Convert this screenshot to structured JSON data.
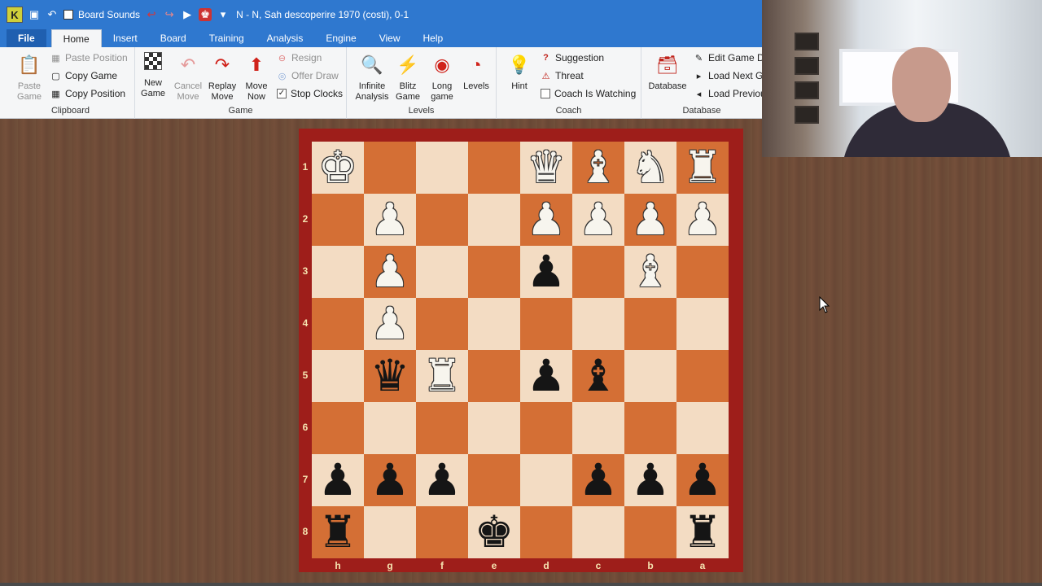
{
  "titlebar": {
    "board_sounds_label": "Board Sounds",
    "title": "N - N, Sah descoperire 1970 (costi), 0-1",
    "app_badge": "K"
  },
  "tabs": [
    "File",
    "Home",
    "Insert",
    "Board",
    "Training",
    "Analysis",
    "Engine",
    "View",
    "Help"
  ],
  "active_tab": "Home",
  "ribbon": {
    "clipboard": {
      "label": "Clipboard",
      "paste_game": "Paste Game",
      "paste_position": "Paste Position",
      "copy_game": "Copy Game",
      "copy_position": "Copy Position"
    },
    "game": {
      "label": "Game",
      "new_game": "New Game",
      "cancel_move": "Cancel Move",
      "replay_move": "Replay Move",
      "move_now": "Move Now",
      "resign": "Resign",
      "offer_draw": "Offer Draw",
      "stop_clocks": "Stop Clocks",
      "stop_clocks_checked": true
    },
    "levels": {
      "label": "Levels",
      "infinite_analysis": "Infinite Analysis",
      "blitz_game": "Blitz Game",
      "long_game": "Long game",
      "levels": "Levels"
    },
    "coach": {
      "label": "Coach",
      "hint": "Hint",
      "suggestion": "Suggestion",
      "threat": "Threat",
      "coach_watching": "Coach Is Watching",
      "coach_watching_checked": false
    },
    "database": {
      "label": "Database",
      "database": "Database",
      "edit_game_data": "Edit Game Da",
      "load_next_game": "Load Next Ga",
      "load_previous": "Load Previou"
    }
  },
  "board": {
    "files": [
      "h",
      "g",
      "f",
      "e",
      "d",
      "c",
      "b",
      "a"
    ],
    "ranks": [
      "1",
      "2",
      "3",
      "4",
      "5",
      "6",
      "7",
      "8"
    ],
    "pieces": [
      {
        "sq": "h1",
        "p": "K",
        "c": "w"
      },
      {
        "sq": "d1",
        "p": "Q",
        "c": "w"
      },
      {
        "sq": "c1",
        "p": "B",
        "c": "w"
      },
      {
        "sq": "b1",
        "p": "N",
        "c": "w"
      },
      {
        "sq": "a1",
        "p": "R",
        "c": "w"
      },
      {
        "sq": "g2",
        "p": "P",
        "c": "w"
      },
      {
        "sq": "d2",
        "p": "P",
        "c": "w"
      },
      {
        "sq": "c2",
        "p": "P",
        "c": "w"
      },
      {
        "sq": "b2",
        "p": "P",
        "c": "w"
      },
      {
        "sq": "a2",
        "p": "P",
        "c": "w"
      },
      {
        "sq": "g3",
        "p": "P",
        "c": "w"
      },
      {
        "sq": "d3",
        "p": "P",
        "c": "b"
      },
      {
        "sq": "b3",
        "p": "B",
        "c": "w"
      },
      {
        "sq": "g4",
        "p": "P",
        "c": "w"
      },
      {
        "sq": "g5",
        "p": "Q",
        "c": "b"
      },
      {
        "sq": "f5",
        "p": "R",
        "c": "w"
      },
      {
        "sq": "d5",
        "p": "P",
        "c": "b"
      },
      {
        "sq": "c5",
        "p": "B",
        "c": "b"
      },
      {
        "sq": "h7",
        "p": "P",
        "c": "b"
      },
      {
        "sq": "g7",
        "p": "P",
        "c": "b"
      },
      {
        "sq": "f7",
        "p": "P",
        "c": "b"
      },
      {
        "sq": "c7",
        "p": "P",
        "c": "b"
      },
      {
        "sq": "b7",
        "p": "P",
        "c": "b"
      },
      {
        "sq": "a7",
        "p": "P",
        "c": "b"
      },
      {
        "sq": "h8",
        "p": "R",
        "c": "b"
      },
      {
        "sq": "e8",
        "p": "K",
        "c": "b"
      },
      {
        "sq": "a8",
        "p": "R",
        "c": "b"
      }
    ]
  },
  "colors": {
    "light_square": "#f3dcc3",
    "dark_square": "#d46f35",
    "board_frame": "#9e1e1a",
    "title_blue": "#2f78cf"
  }
}
